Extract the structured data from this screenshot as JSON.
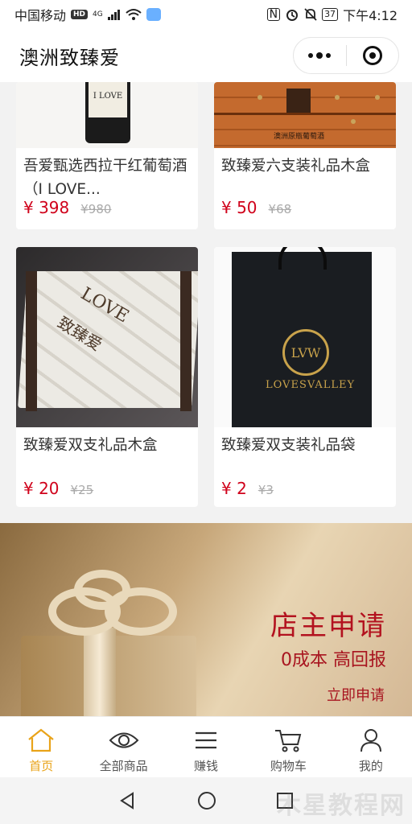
{
  "status_bar": {
    "carrier": "中国移动",
    "hd": "HD",
    "network": "4G",
    "battery": "37",
    "time": "下午4:12"
  },
  "header": {
    "title": "澳洲致臻爱",
    "menu_icon": "more-dots-icon",
    "close_icon": "target-close-icon"
  },
  "products": [
    {
      "name": "吾爱甄选西拉干红葡萄酒（I LOVE...",
      "price": "¥ 398",
      "original_price": "¥980",
      "image": "wine-bottle",
      "bottle_label": "I LOVE"
    },
    {
      "name": "致臻爱六支装礼品木盒",
      "price": "¥ 50",
      "original_price": "¥68",
      "image": "wooden-box-six",
      "box_print": "澳洲原瓶葡萄酒"
    },
    {
      "name": "致臻爱双支礼品木盒",
      "price": "¥ 20",
      "original_price": "¥25",
      "image": "wooden-box-two",
      "box_logo": "LOVE",
      "box_cn": "致臻爱"
    },
    {
      "name": "致臻爱双支装礼品袋",
      "price": "¥ 2",
      "original_price": "¥3",
      "image": "gift-bag",
      "bag_emblem": "LVW",
      "bag_brand": "LOVESVALLEY"
    }
  ],
  "banner": {
    "title": "店主申请",
    "subtitle": "0成本 高回报",
    "link": "立即申请"
  },
  "tabs": [
    {
      "label": "首页",
      "icon": "home-icon",
      "active": true
    },
    {
      "label": "全部商品",
      "icon": "eye-icon",
      "active": false
    },
    {
      "label": "赚钱",
      "icon": "menu-lines-icon",
      "active": false
    },
    {
      "label": "购物车",
      "icon": "cart-icon",
      "active": false
    },
    {
      "label": "我的",
      "icon": "user-icon",
      "active": false
    }
  ],
  "system_nav": [
    "back-icon",
    "home-circle-icon",
    "recents-icon"
  ],
  "watermark": "木星教程网",
  "colors": {
    "price": "#d0021b",
    "active_tab": "#e9a319",
    "banner_text": "#b3121f"
  }
}
